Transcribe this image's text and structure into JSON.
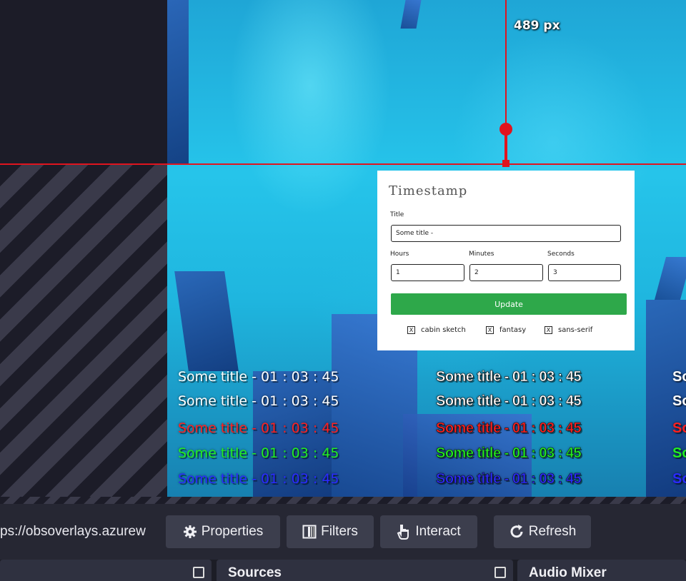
{
  "measure": {
    "label": "489 px"
  },
  "panel": {
    "title": "Timestamp",
    "title_label": "Title",
    "title_value": "Some title -",
    "hours_label": "Hours",
    "minutes_label": "Minutes",
    "seconds_label": "Seconds",
    "hours_value": "1",
    "minutes_value": "2",
    "seconds_value": "3",
    "update_label": "Update",
    "fonts": [
      {
        "label": "cabin sketch",
        "checked": "X"
      },
      {
        "label": "fantasy",
        "checked": "X"
      },
      {
        "label": "sans-serif",
        "checked": "X"
      }
    ]
  },
  "overlay": {
    "text": "Some title - 01 : 03 : 45",
    "colors": [
      "#ffffff",
      "#ffffff",
      "#ff2020",
      "#22ee22",
      "#2a2aff"
    ],
    "partial_text": "So"
  },
  "toolbar": {
    "url": "ps://obsoverlays.azurew",
    "properties_label": "Properties",
    "filters_label": "Filters",
    "interact_label": "Interact",
    "refresh_label": "Refresh"
  },
  "docks": {
    "sources_label": "Sources",
    "audio_mixer_label": "Audio Mixer"
  }
}
